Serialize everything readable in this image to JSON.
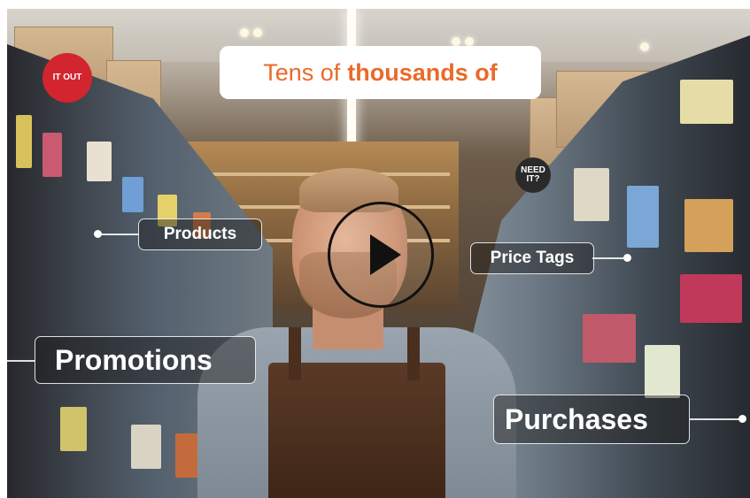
{
  "video": {
    "title_text": "Tens of",
    "title_bold": "thousands of",
    "labels": {
      "products": "Products",
      "price_tags": "Price Tags",
      "promotions": "Promotions",
      "purchases": "Purchases"
    },
    "signs": {
      "left_sign": "IT OUT",
      "right_sign": "NEED IT?"
    },
    "play_icon": "play-icon",
    "colors": {
      "title_accent": "#ea6a2a",
      "label_border": "#ffffff"
    }
  }
}
